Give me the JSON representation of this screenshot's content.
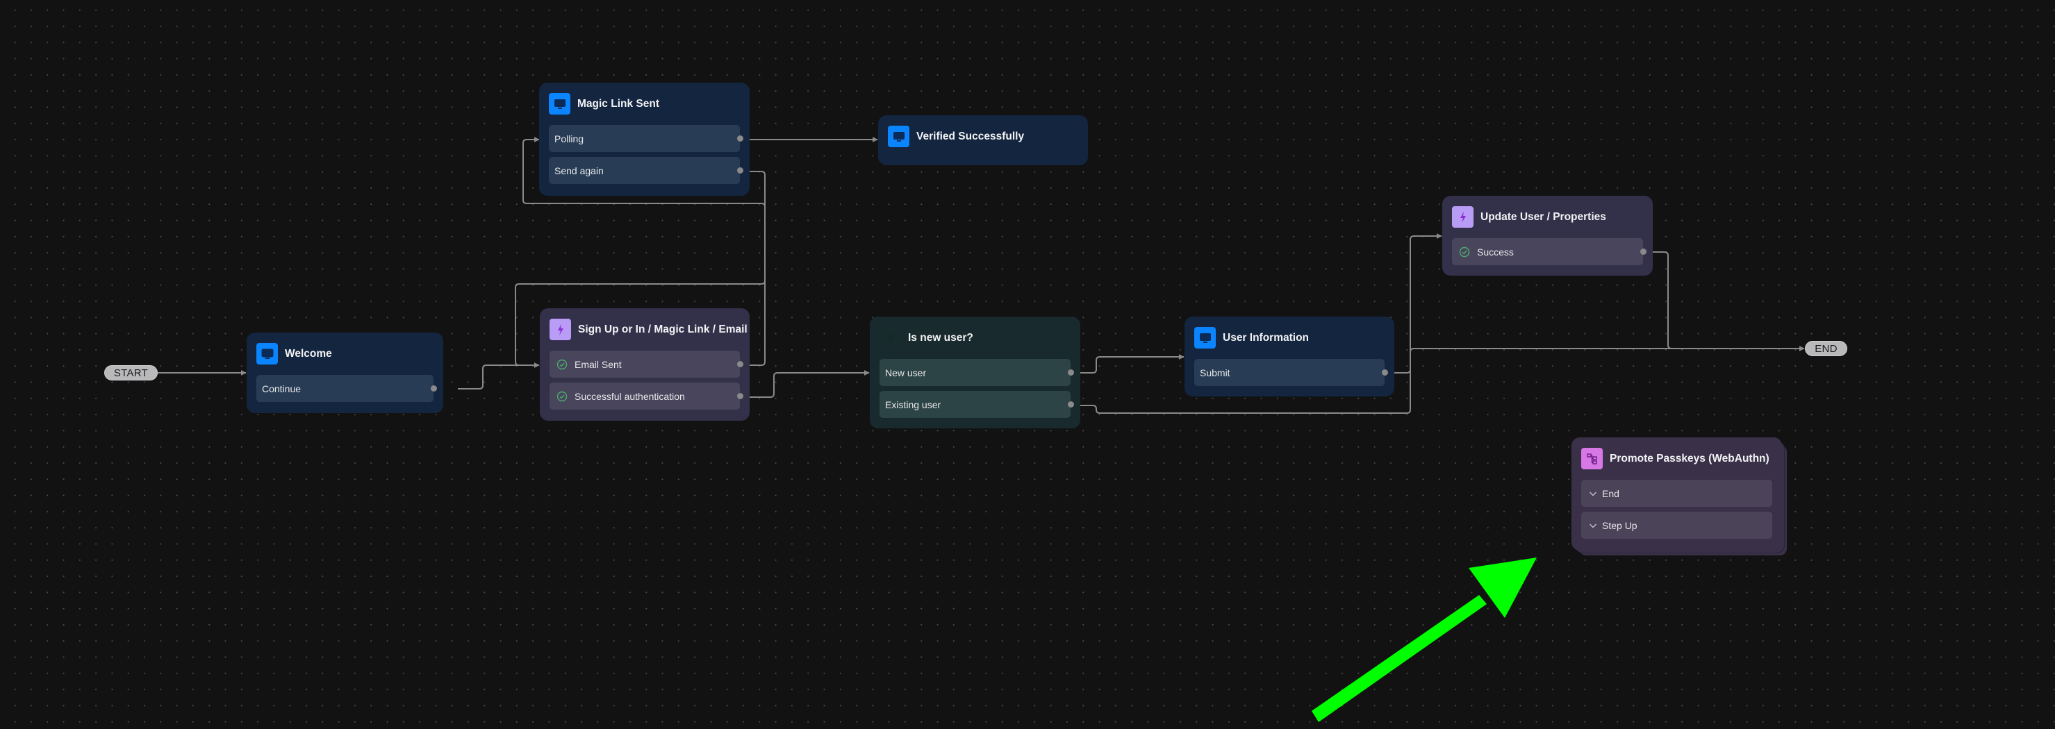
{
  "canvas": {
    "type": "flow-editor"
  },
  "terminals": {
    "start": {
      "label": "START"
    },
    "end": {
      "label": "END"
    }
  },
  "nodes": {
    "welcome": {
      "title": "Welcome",
      "type": "screen",
      "icon": "monitor-icon",
      "rows": [
        {
          "label": "Continue"
        }
      ]
    },
    "magic_link_sent": {
      "title": "Magic Link Sent",
      "type": "screen",
      "icon": "monitor-icon",
      "rows": [
        {
          "label": "Polling"
        },
        {
          "label": "Send again"
        }
      ]
    },
    "verified": {
      "title": "Verified Successfully",
      "type": "screen",
      "icon": "monitor-icon",
      "rows": []
    },
    "sign_up": {
      "title": "Sign Up or In / Magic Link / Email",
      "type": "action",
      "icon": "lightning-icon",
      "rows": [
        {
          "label": "Email Sent",
          "status": "success"
        },
        {
          "label": "Successful authentication",
          "status": "success"
        }
      ]
    },
    "is_new_user": {
      "title": "Is new user?",
      "type": "condition",
      "icon": "split-icon",
      "rows": [
        {
          "label": "New user"
        },
        {
          "label": "Existing user"
        }
      ]
    },
    "user_info": {
      "title": "User Information",
      "type": "screen",
      "icon": "monitor-icon",
      "rows": [
        {
          "label": "Submit"
        }
      ]
    },
    "update_user": {
      "title": "Update User / Properties",
      "type": "action",
      "icon": "lightning-icon",
      "rows": [
        {
          "label": "Success",
          "status": "success"
        }
      ]
    },
    "promote_passkeys": {
      "title": "Promote Passkeys (WebAuthn)",
      "type": "subflow",
      "icon": "flow-icon",
      "rows": [
        {
          "label": "End",
          "collapsed": true
        },
        {
          "label": "Step Up",
          "collapsed": true
        }
      ]
    }
  },
  "edges": [
    {
      "from": "start",
      "to": "welcome"
    },
    {
      "from": "welcome.Continue",
      "to": "sign_up"
    },
    {
      "from": "sign_up.Email Sent",
      "to": "magic_link_sent"
    },
    {
      "from": "sign_up.Successful authentication",
      "to": "is_new_user"
    },
    {
      "from": "magic_link_sent.Polling",
      "to": "verified"
    },
    {
      "from": "magic_link_sent.Send again",
      "to": "sign_up"
    },
    {
      "from": "is_new_user.New user",
      "to": "user_info"
    },
    {
      "from": "is_new_user.Existing user",
      "to": "end"
    },
    {
      "from": "user_info.Submit",
      "to": "update_user"
    },
    {
      "from": "update_user.Success",
      "to": "end"
    }
  ],
  "colors": {
    "screen_icon": "#0a84ff",
    "action_icon": "#b99cf5",
    "condition_icon": "#3ecf9f",
    "subflow_icon": "#d877e6",
    "success": "#4caf6a",
    "edge": "#8a8a8a",
    "annotation_arrow": "#00ff00"
  },
  "annotation": {
    "type": "arrow",
    "points_to": "promote_passkeys"
  }
}
